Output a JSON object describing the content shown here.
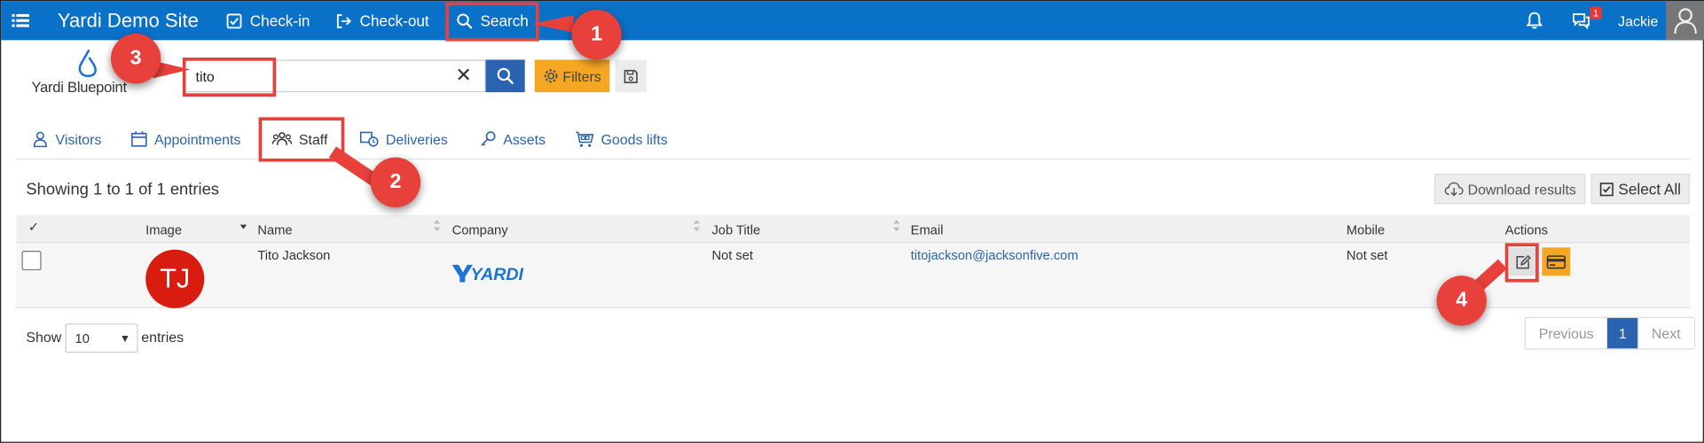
{
  "app": {
    "title": "Yardi Demo Site"
  },
  "nav": [
    {
      "label": "Check-in",
      "icon": "checkbox-icon"
    },
    {
      "label": "Check-out",
      "icon": "exit-icon"
    },
    {
      "label": "Search",
      "icon": "search-icon"
    }
  ],
  "header": {
    "notification_count": "1",
    "username": "Jackie"
  },
  "logo": {
    "text": "Yardi Bluepoint"
  },
  "search": {
    "value": "tito",
    "filters_label": "Filters"
  },
  "tabs": [
    {
      "label": "Visitors",
      "icon": "visitor-icon"
    },
    {
      "label": "Appointments",
      "icon": "calendar-icon"
    },
    {
      "label": "Staff",
      "icon": "people-icon",
      "active": true
    },
    {
      "label": "Deliveries",
      "icon": "delivery-icon"
    },
    {
      "label": "Assets",
      "icon": "key-icon"
    },
    {
      "label": "Goods lifts",
      "icon": "cart-icon"
    }
  ],
  "table": {
    "info": "Showing 1 to 1 of 1 entries",
    "download_label": "Download results",
    "select_all_label": "Select All",
    "columns": [
      "✓",
      "Image",
      "Name",
      "Company",
      "Job Title",
      "Email",
      "Mobile",
      "Actions"
    ],
    "rows": [
      {
        "initials": "TJ",
        "name": "Tito Jackson",
        "company_logo": "YARDI",
        "job_title": "Not set",
        "email": "titojackson@jacksonfive.com",
        "mobile": "Not set"
      }
    ]
  },
  "length": {
    "show": "Show",
    "value": "10",
    "entries": "entries"
  },
  "pagination": {
    "previous": "Previous",
    "page": "1",
    "next": "Next"
  },
  "callouts": [
    "1",
    "2",
    "3",
    "4"
  ],
  "colors": {
    "topbar": "#0a71c8",
    "callout": "#e8403b",
    "primary": "#2a64b0",
    "accent": "#f5a623",
    "avatar": "#d91c10"
  }
}
